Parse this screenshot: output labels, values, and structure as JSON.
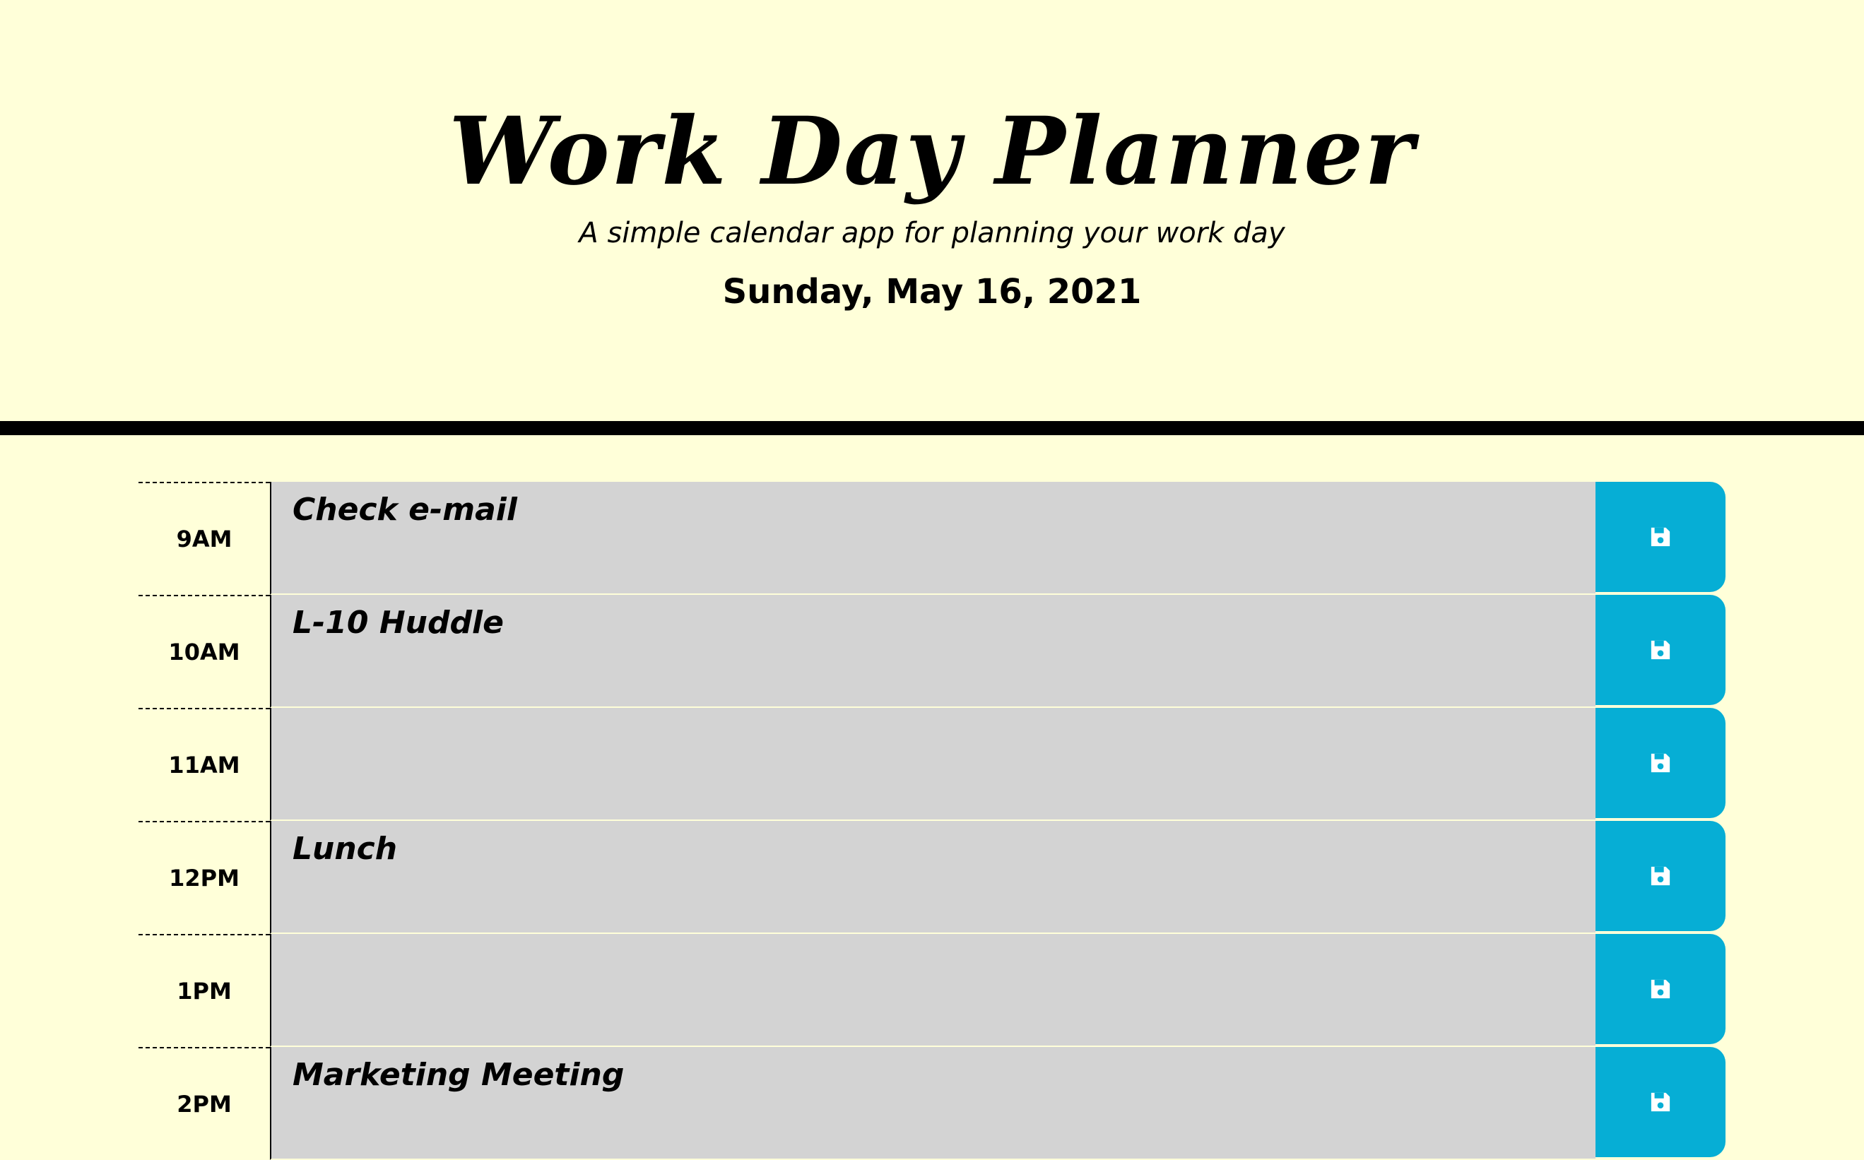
{
  "header": {
    "title": "Work Day Planner",
    "lead": "A simple calendar app for planning your work day",
    "current_day": "Sunday, May 16, 2021"
  },
  "colors": {
    "background": "#ffffd9",
    "past_block": "#d3d3d3",
    "save_button": "#06aed5"
  },
  "rows": [
    {
      "hour": "9AM",
      "text": "Check e-mail",
      "icon": "save-icon"
    },
    {
      "hour": "10AM",
      "text": "L-10 Huddle",
      "icon": "save-icon"
    },
    {
      "hour": "11AM",
      "text": "",
      "icon": "save-icon"
    },
    {
      "hour": "12PM",
      "text": "Lunch",
      "icon": "save-icon"
    },
    {
      "hour": "1PM",
      "text": "",
      "icon": "save-icon"
    },
    {
      "hour": "2PM",
      "text": "Marketing Meeting",
      "icon": "save-icon"
    }
  ]
}
